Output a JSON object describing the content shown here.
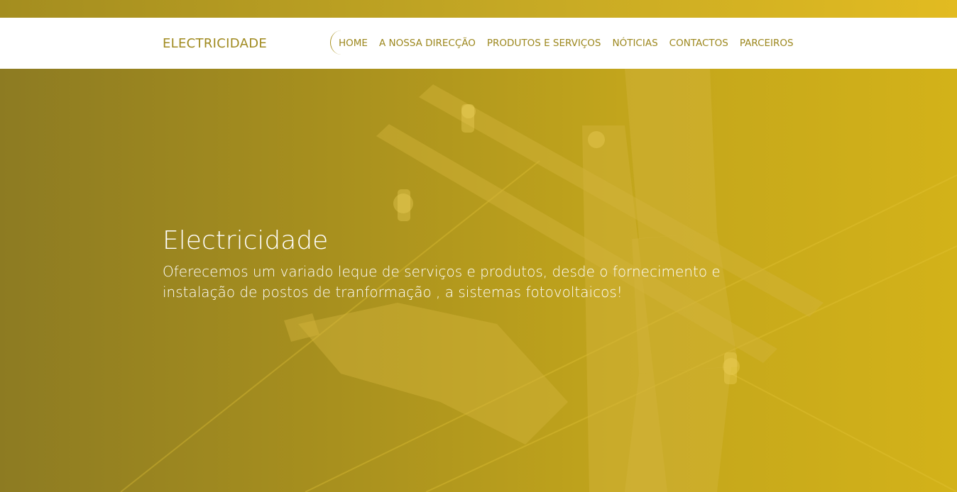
{
  "header": {
    "brand": "ELECTRICIDADE"
  },
  "nav": {
    "items": [
      {
        "label": "HOME",
        "active": true
      },
      {
        "label": "A NOSSA DIRECÇÃO"
      },
      {
        "label": "PRODUTOS E SERVIÇOS"
      },
      {
        "label": "NÓTICIAS"
      },
      {
        "label": "CONTACTOS"
      },
      {
        "label": "PARCEIROS"
      }
    ]
  },
  "hero": {
    "title": "Electricidade",
    "text": "Oferecemos um variado leque de serviços e produtos, desde o fornecimento e instalação de postos de tranformação , a sistemas fotovoltaicos!"
  },
  "colors": {
    "accent": "#a08a1f",
    "hero_overlay_left": "#8d7b22",
    "hero_overlay_right": "#d3b219",
    "nav_bg": "#ffffff"
  }
}
